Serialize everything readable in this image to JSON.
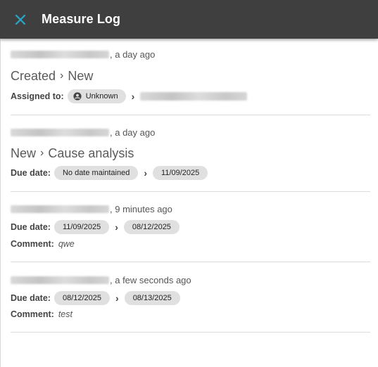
{
  "header": {
    "title": "Measure Log",
    "close_icon": "close-icon",
    "accent": "#29a8c9",
    "bar_color": "#3f3f3f"
  },
  "entries": [
    {
      "time": ", a day ago",
      "heading": {
        "from": "Created",
        "to": "New"
      },
      "field": {
        "label": "Assigned to:",
        "from": "Unknown",
        "from_icon": "user-circle-icon"
      }
    },
    {
      "time": ", a day ago",
      "heading": {
        "from": "New",
        "to": "Cause analysis"
      },
      "field": {
        "label": "Due date:",
        "from": "No date maintained",
        "to": "11/09/2025"
      }
    },
    {
      "time": ", 9 minutes ago",
      "field": {
        "label": "Due date:",
        "from": "11/09/2025",
        "to": "08/12/2025"
      },
      "comment": {
        "label": "Comment:",
        "value": "qwe"
      }
    },
    {
      "time": ", a few seconds ago",
      "field": {
        "label": "Due date:",
        "from": "08/12/2025",
        "to": "08/13/2025"
      },
      "comment": {
        "label": "Comment:",
        "value": "test"
      }
    }
  ]
}
